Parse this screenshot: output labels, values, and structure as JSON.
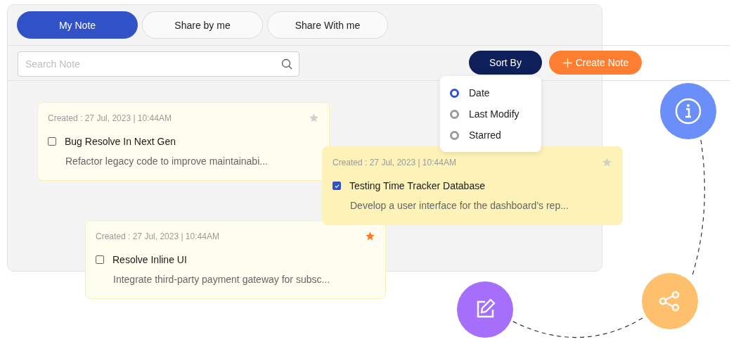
{
  "tabs": [
    {
      "label": "My Note",
      "selected": true
    },
    {
      "label": "Share by me",
      "selected": false
    },
    {
      "label": "Share With me",
      "selected": false
    }
  ],
  "search": {
    "placeholder": "Search Note"
  },
  "sort_button": {
    "label": "Sort By"
  },
  "create_button": {
    "label": "Create Note"
  },
  "sort_menu": [
    {
      "label": "Date",
      "selected": true
    },
    {
      "label": "Last Modify",
      "selected": false
    },
    {
      "label": "Starred",
      "selected": false
    }
  ],
  "notes": [
    {
      "created": "Created : 27 Jul, 2023 | 10:44AM",
      "title": "Bug Resolve In Next Gen",
      "description": "Refactor legacy code to improve maintainabi...",
      "checked": false,
      "starred": false,
      "highlighted": false
    },
    {
      "created": "Created : 27 Jul, 2023 | 10:44AM",
      "title": "Testing Time Tracker Database",
      "description": "Develop a user interface for the dashboard's rep...",
      "checked": true,
      "starred": false,
      "highlighted": true
    },
    {
      "created": "Created : 27 Jul, 2023 | 10:44AM",
      "title": "Resolve Inline UI",
      "description": "Integrate third-party payment gateway for subsc...",
      "checked": false,
      "starred": true,
      "highlighted": false
    }
  ]
}
